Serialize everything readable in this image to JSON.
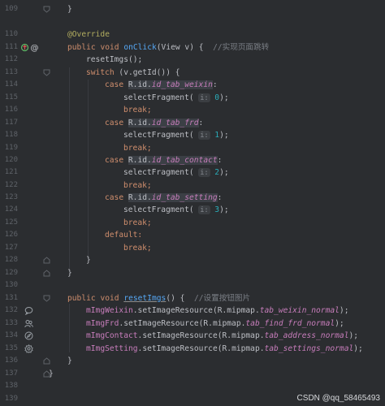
{
  "editor": {
    "lines": [
      {
        "num": "109",
        "text": "    }"
      },
      {
        "num": "110",
        "text": ""
      },
      {
        "num": "111",
        "text": "    @Override"
      },
      {
        "num": "112",
        "text": "    public void onClick(View v) {  //实现页面跳转"
      },
      {
        "num": "113",
        "text": "        resetImgs();"
      },
      {
        "num": "114",
        "text": "        switch (v.getId()) {"
      },
      {
        "num": "115",
        "text": "            case R.id.id_tab_weixin:"
      },
      {
        "num": "116",
        "text": "                selectFragment( i: 0);"
      },
      {
        "num": "117",
        "text": "                break;"
      },
      {
        "num": "118",
        "text": "            case R.id.id_tab_frd:"
      },
      {
        "num": "119",
        "text": "                selectFragment( i: 1);"
      },
      {
        "num": "120",
        "text": "                break;"
      },
      {
        "num": "121",
        "text": "            case R.id.id_tab_contact:"
      },
      {
        "num": "122",
        "text": "                selectFragment( i: 2);"
      },
      {
        "num": "123",
        "text": "                break;"
      },
      {
        "num": "124",
        "text": "            case R.id.id_tab_setting:"
      },
      {
        "num": "125",
        "text": "                selectFragment( i: 3);"
      },
      {
        "num": "126",
        "text": "                break;"
      },
      {
        "num": "127",
        "text": "            default:"
      },
      {
        "num": "128",
        "text": "                break;"
      },
      {
        "num": "129",
        "text": "        }"
      },
      {
        "num": "130",
        "text": "    }"
      },
      {
        "num": "131",
        "text": ""
      },
      {
        "num": "132",
        "text": "    public void resetImgs() {  //设置按钮图片"
      },
      {
        "num": "133",
        "text": "        mImgWeixin.setImageResource(R.mipmap.tab_weixin_normal);"
      },
      {
        "num": "134",
        "text": "        mImgFrd.setImageResource(R.mipmap.tab_find_frd_normal);"
      },
      {
        "num": "135",
        "text": "        mImgContact.setImageResource(R.mipmap.tab_address_normal);"
      },
      {
        "num": "136",
        "text": "        mImgSetting.setImageResource(R.mipmap.tab_settings_normal);"
      },
      {
        "num": "137",
        "text": "    }"
      },
      {
        "num": "138",
        "text": "}"
      },
      {
        "num": "139",
        "text": ""
      }
    ]
  },
  "tokens": {
    "override": "@Override",
    "public": "public",
    "void": "void",
    "onClick": "onClick",
    "onClick_params": "(View v) {  ",
    "comment_jump": "//实现页面跳转",
    "resetImgs_call": "resetImgs();",
    "switch": "switch",
    "switch_rest": " (v.getId()) {",
    "case": "case",
    "r_id": "R.id.",
    "id_weixin": "id_tab_weixin",
    "id_frd": "id_tab_frd",
    "id_contact": "id_tab_contact",
    "id_setting": "id_tab_setting",
    "colon": ":",
    "selectFragment": "selectFragment(",
    "hint_i": "i:",
    "v0": "0",
    "v1": "1",
    "v2": "2",
    "v3": "3",
    "close_call": ");",
    "break": "break;",
    "default": "default:",
    "brace_close": "}",
    "resetImgs_name": "resetImgs",
    "resetImgs_params": "() {  ",
    "comment_buttons": "//设置按钮图片",
    "mImgWeixin": "mImgWeixin",
    "mImgFrd": "mImgFrd",
    "mImgContact": "mImgContact",
    "mImgSetting": "mImgSetting",
    "setImageResource": ".setImageResource(R.mipmap.",
    "res_weixin": "tab_weixin_normal",
    "res_frd": "tab_find_frd_normal",
    "res_address": "tab_address_normal",
    "res_settings": "tab_settings_normal"
  },
  "line_numbers": [
    "109",
    "110",
    "111",
    "112",
    "113",
    "114",
    "115",
    "116",
    "117",
    "118",
    "119",
    "120",
    "121",
    "122",
    "123",
    "124",
    "125",
    "126",
    "127",
    "128",
    "129",
    "130",
    "131",
    "132",
    "133",
    "134",
    "135",
    "136",
    "137",
    "138",
    "139"
  ],
  "gutter_icons": {
    "override_marker": "override-up-icon",
    "at_marker": "annotation-at-icon",
    "img1": "chat-bubble-icon",
    "img2": "users-icon",
    "img3": "compass-icon",
    "img4": "gear-icon"
  },
  "watermark": "CSDN @qq_58465493",
  "colors": {
    "background": "#2b2d30",
    "keyword": "#cf8e6d",
    "annotation": "#b3ae60",
    "method": "#56a8f5",
    "field": "#c77dbb",
    "number": "#2aacb8",
    "comment": "#7a7e85"
  }
}
